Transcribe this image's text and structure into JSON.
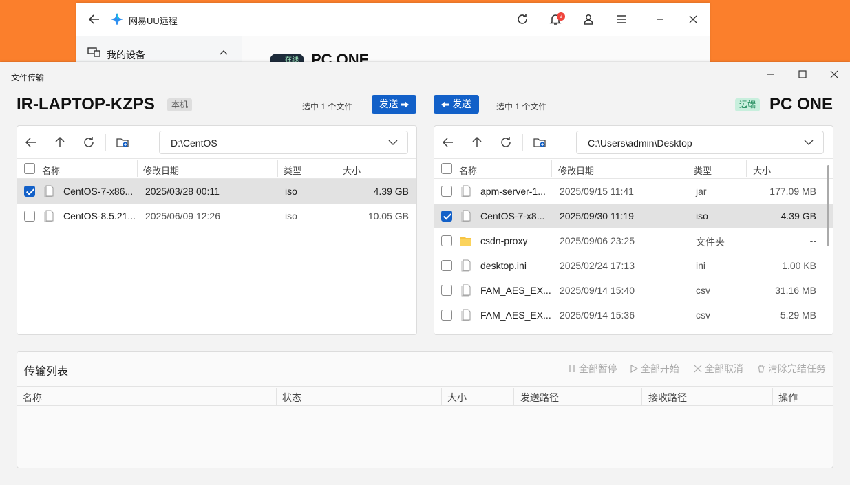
{
  "bg_app": {
    "title": "网易UU远程",
    "notification_count": "2",
    "sidebar_label": "我的设备",
    "status_pill": "在线",
    "device_title": "PC ONE"
  },
  "window": {
    "title": "文件传输"
  },
  "local": {
    "host": "IR-LAPTOP-KZPS",
    "tag": "本机",
    "selection": "选中 1 个文件",
    "send_label": "发送",
    "path": "D:\\CentOS",
    "columns": [
      "名称",
      "修改日期",
      "类型",
      "大小"
    ],
    "rows": [
      {
        "name": "CentOS-7-x86...",
        "date": "2025/03/28 00:11",
        "type": "iso",
        "size": "4.39 GB",
        "checked": true,
        "selected": true,
        "kind": "file"
      },
      {
        "name": "CentOS-8.5.21...",
        "date": "2025/06/09 12:26",
        "type": "iso",
        "size": "10.05 GB",
        "checked": false,
        "selected": false,
        "kind": "file"
      }
    ]
  },
  "remote": {
    "host": "PC ONE",
    "tag": "远端",
    "selection": "选中 1 个文件",
    "send_label": "发送",
    "path": "C:\\Users\\admin\\Desktop",
    "columns": [
      "名称",
      "修改日期",
      "类型",
      "大小"
    ],
    "rows": [
      {
        "name": "apm-server-1...",
        "date": "2025/09/15 11:41",
        "type": "jar",
        "size": "177.09 MB",
        "checked": false,
        "selected": false,
        "kind": "file"
      },
      {
        "name": "CentOS-7-x8...",
        "date": "2025/09/30 11:19",
        "type": "iso",
        "size": "4.39 GB",
        "checked": true,
        "selected": true,
        "kind": "file"
      },
      {
        "name": "csdn-proxy",
        "date": "2025/09/06 23:25",
        "type": "文件夹",
        "size": "--",
        "checked": false,
        "selected": false,
        "kind": "folder"
      },
      {
        "name": "desktop.ini",
        "date": "2025/02/24 17:13",
        "type": "ini",
        "size": "1.00 KB",
        "checked": false,
        "selected": false,
        "kind": "file"
      },
      {
        "name": "FAM_AES_EX...",
        "date": "2025/09/14 15:40",
        "type": "csv",
        "size": "31.16 MB",
        "checked": false,
        "selected": false,
        "kind": "file"
      },
      {
        "name": "FAM_AES_EX...",
        "date": "2025/09/14 15:36",
        "type": "csv",
        "size": "5.29 MB",
        "checked": false,
        "selected": false,
        "kind": "file"
      }
    ]
  },
  "queue": {
    "title": "传输列表",
    "actions": {
      "pause_all": "全部暂停",
      "start_all": "全部开始",
      "cancel_all": "全部取消",
      "clear_done": "清除完结任务"
    },
    "columns": [
      "名称",
      "状态",
      "大小",
      "发送路径",
      "接收路径",
      "操作"
    ]
  },
  "colors": {
    "accent": "#1260c8",
    "orange_bg": "#fb7f2c",
    "selected_row": "#e2e2e2"
  }
}
